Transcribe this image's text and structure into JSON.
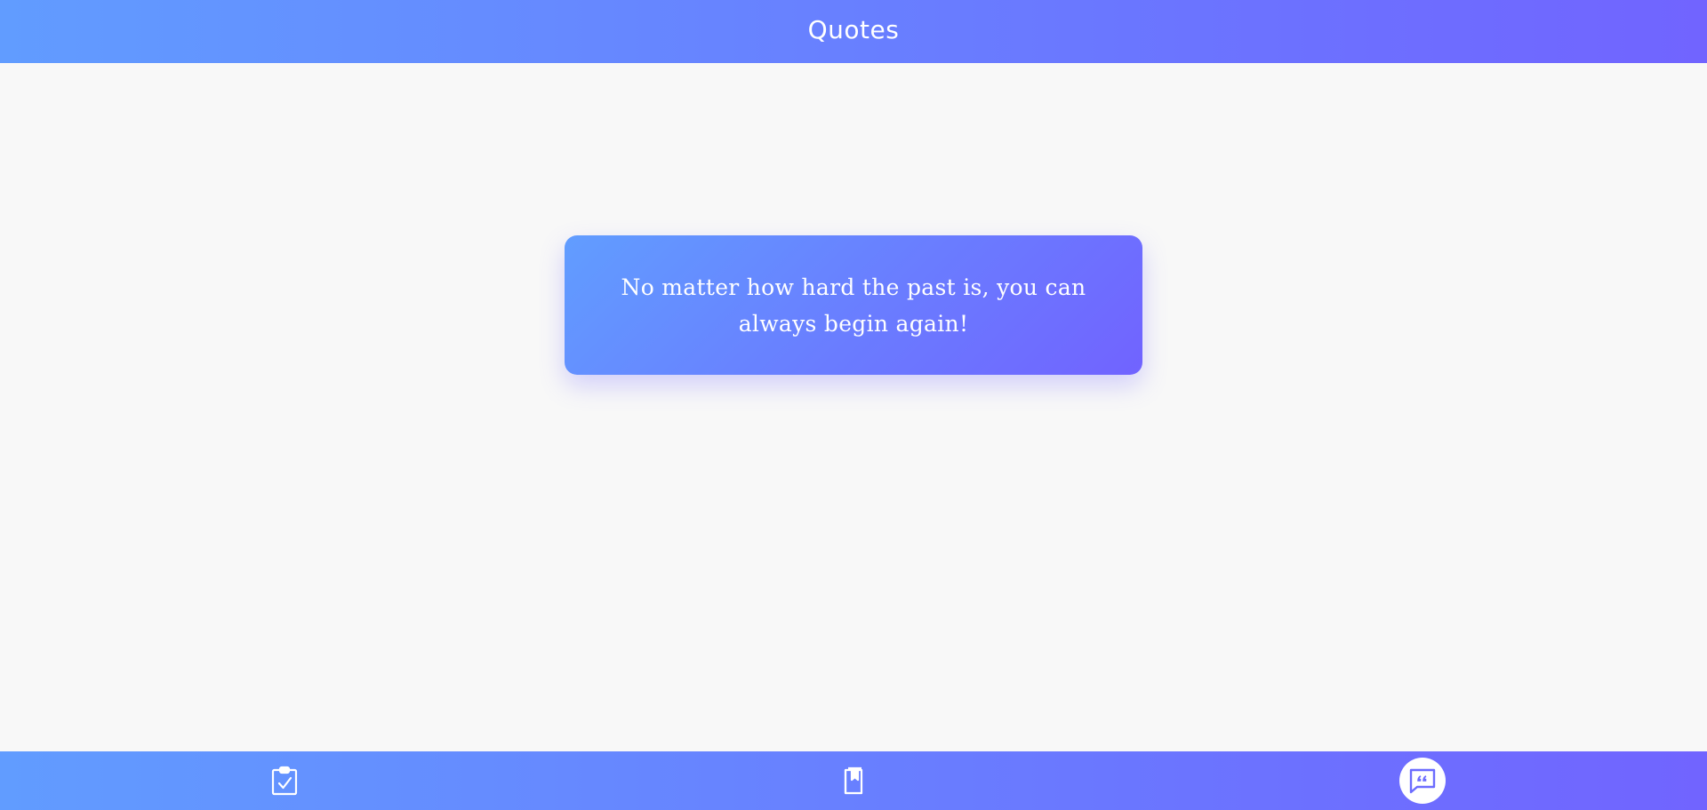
{
  "header": {
    "title": "Quotes"
  },
  "quote": {
    "text": "No matter how hard the past is, you can always begin again!"
  },
  "bottom_nav": {
    "items": [
      {
        "icon": "clipboard-check-icon",
        "active": false
      },
      {
        "icon": "book-bookmark-icon",
        "active": false
      },
      {
        "icon": "quote-message-icon",
        "active": true
      }
    ]
  },
  "colors": {
    "gradient_start": "#619cff",
    "gradient_end": "#7164ff",
    "background": "#f8f8f8",
    "active_nav_bg": "#ffffff",
    "active_icon": "#6c6cff"
  }
}
